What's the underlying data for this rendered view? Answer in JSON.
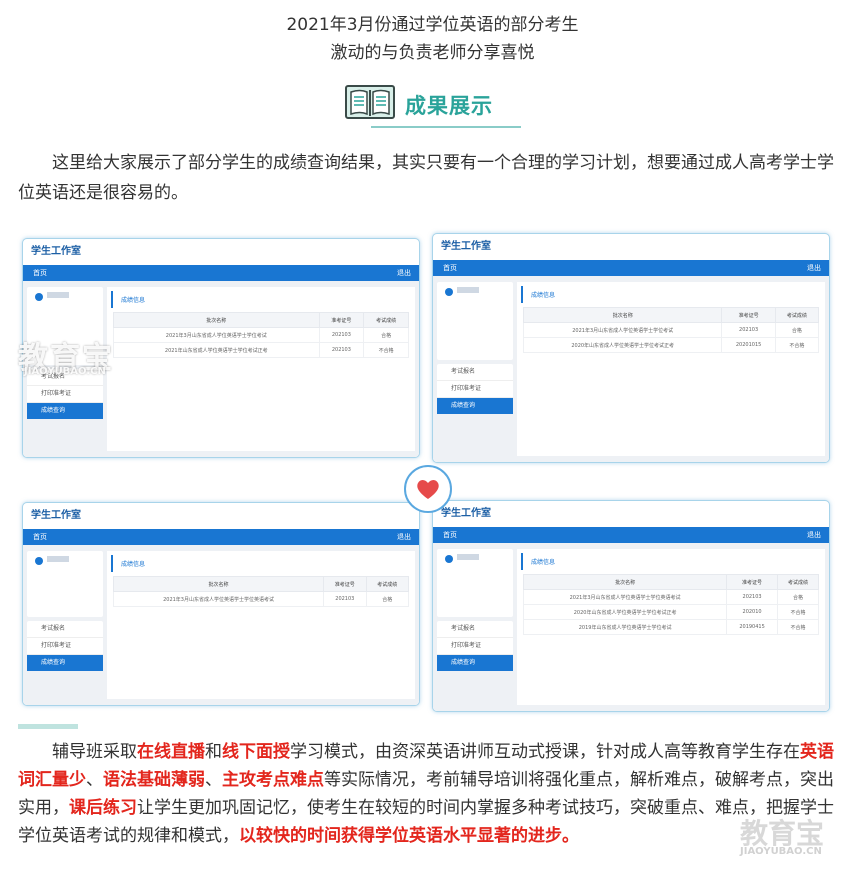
{
  "header": {
    "line1": "2021年3月份通过学位英语的部分考生",
    "line2": "激动的与负责老师分享喜悦"
  },
  "section": {
    "icon": "book-icon",
    "title": "成果展示",
    "accent": "#2aa39a"
  },
  "intro": "这里给大家展示了部分学生的成绩查询结果，其实只要有一个合理的学习计划，想要通过成人高考学士学位英语还是很容易的。",
  "screenshots": {
    "app_title": "学生工作室",
    "nav_home": "首页",
    "nav_home_alt": "首页",
    "nav_exit": "退出",
    "menu": [
      "考试报名",
      "打印准考证",
      "成绩查询"
    ],
    "panel_title": "成绩信息",
    "columns": [
      "批次名称",
      "准考证号",
      "考试成绩"
    ],
    "card1_rows": [
      [
        "2021年3月山东省成人学位英语学士学位考试",
        "202103",
        "合格"
      ],
      [
        "2021年山东省成人学位英语学士学位考试正考",
        "202103",
        "不合格"
      ]
    ],
    "card2_rows": [
      [
        "2021年3月山东省成人学位英语学士学位考试",
        "202103",
        "合格"
      ],
      [
        "2020年山东省成人学位英语学士学位考试正考",
        "20201015",
        "不合格"
      ]
    ],
    "card3_rows": [
      [
        "2021年3月山东省成人学位英语学士学位英语考试",
        "202103",
        "合格"
      ]
    ],
    "card4_rows": [
      [
        "2021年3月山东省成人学位英语学士学位英语考试",
        "202103",
        "合格"
      ],
      [
        "2020年山东省成人学位英语学士学位考试正考",
        "202010",
        "不合格"
      ],
      [
        "2019年山东省成人学位英语学士学位考试",
        "20190415",
        "不合格"
      ]
    ],
    "accent": "#1976d2"
  },
  "watermark": {
    "text": "教育宝",
    "url": "JIAOYUBAO.CN"
  },
  "body": {
    "t1": "辅导班采取",
    "h1": "在线直播",
    "t2": "和",
    "h2": "线下面授",
    "t3": "学习模式，由资深英语讲师互动式授课，针对成人高等教育学生存在",
    "h3": "英语词汇量少",
    "t4": "、",
    "h4": "语法基础薄弱",
    "t5": "、",
    "h5": "主攻考点难点",
    "t6": "等实际情况，考前辅导培训将强化重点，解析难点，破解考点，突出实用，",
    "h6": "课后练习",
    "t7": "让学生更加巩固记忆，使考生在较短的时间内掌握多种考试技巧，突破重点、难点，把握学士学位英语考试的规律和模式，",
    "h7": "以较快的时间获得学位英语水平显著的进步。",
    "highlight_color": "#e3261d"
  }
}
